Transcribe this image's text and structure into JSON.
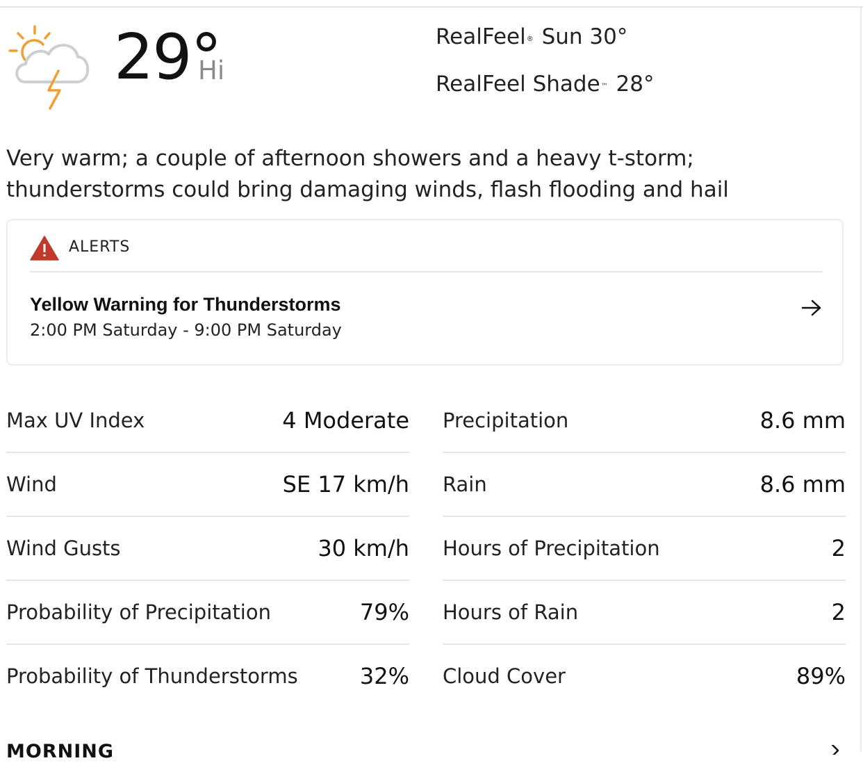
{
  "current": {
    "icon": "sun-cloud-thunderstorm-icon",
    "temperature": "29°",
    "temperature_label": "Hi",
    "realfeel_label": "RealFeel",
    "realfeel_mark": "®",
    "realfeel_value": "Sun 30°",
    "realfeel_shade_label": "RealFeel Shade",
    "realfeel_shade_mark": "™",
    "realfeel_shade_value": "28°",
    "phrase": "Very warm; a couple of afternoon showers and a heavy t-storm; thunderstorms could bring damaging winds, flash flooding and hail"
  },
  "alerts": {
    "title": "ALERTS",
    "icon": "warning-triangle-icon",
    "items": [
      {
        "name": "Yellow Warning for Thunderstorms",
        "time": "2:00 PM Saturday - 9:00 PM Saturday",
        "action_icon": "arrow-right-icon"
      }
    ]
  },
  "details": {
    "left": [
      {
        "label": "Max UV Index",
        "value": "4 Moderate"
      },
      {
        "label": "Wind",
        "value": "SE 17 km/h"
      },
      {
        "label": "Wind Gusts",
        "value": "30 km/h"
      },
      {
        "label": "Probability of Precipitation",
        "value": "79%"
      },
      {
        "label": "Probability of Thunderstorms",
        "value": "32%"
      }
    ],
    "right": [
      {
        "label": "Precipitation",
        "value": "8.6 mm"
      },
      {
        "label": "Rain",
        "value": "8.6 mm"
      },
      {
        "label": "Hours of Precipitation",
        "value": "2"
      },
      {
        "label": "Hours of Rain",
        "value": "2"
      },
      {
        "label": "Cloud Cover",
        "value": "89%"
      }
    ]
  },
  "next_section": {
    "title": "MORNING",
    "icon": "chevron-right-icon"
  },
  "colors": {
    "accent_orange": "#f0a030",
    "alert_red": "#c0392b",
    "divider": "#e6e6e6"
  }
}
